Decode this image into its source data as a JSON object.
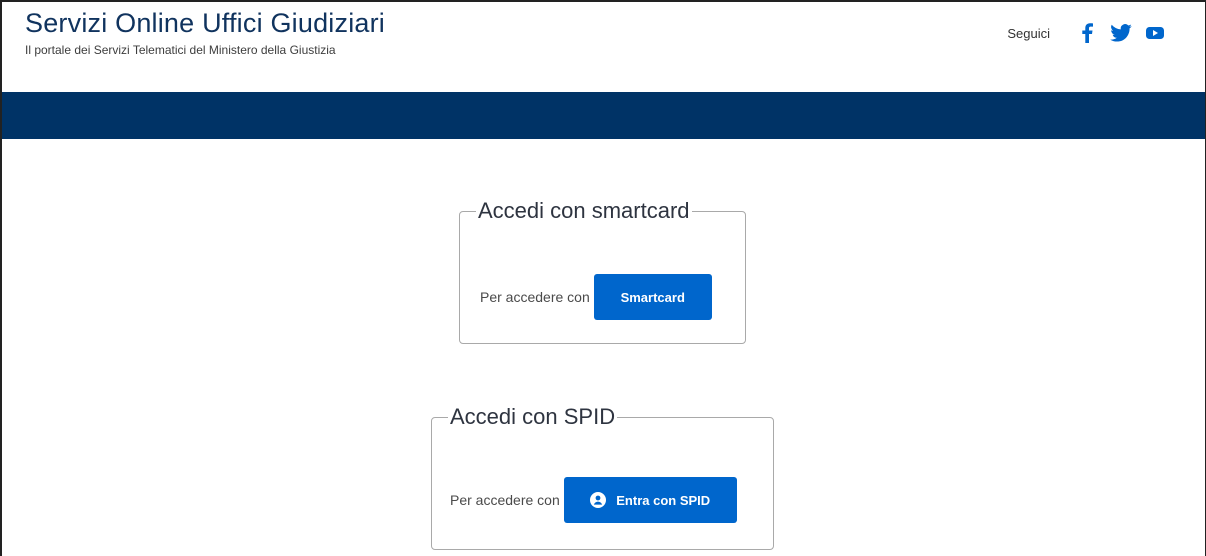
{
  "header": {
    "title": "Servizi Online Uffici Giudiziari",
    "subtitle": "Il portale dei Servizi Telematici del Ministero della Giustizia",
    "social_label": "Seguici",
    "social_icons": [
      "facebook-icon",
      "twitter-icon",
      "youtube-icon"
    ]
  },
  "colors": {
    "brand": "#10335e",
    "navbar": "#003366",
    "button": "#0066cc"
  },
  "smartcard": {
    "legend": "Accedi con smartcard",
    "text": "Per accedere con",
    "button_label": "Smartcard"
  },
  "spid": {
    "legend": "Accedi con SPID",
    "text": "Per accedere con",
    "button_label": "Entra con SPID",
    "button_icon": "user-circle-icon"
  }
}
